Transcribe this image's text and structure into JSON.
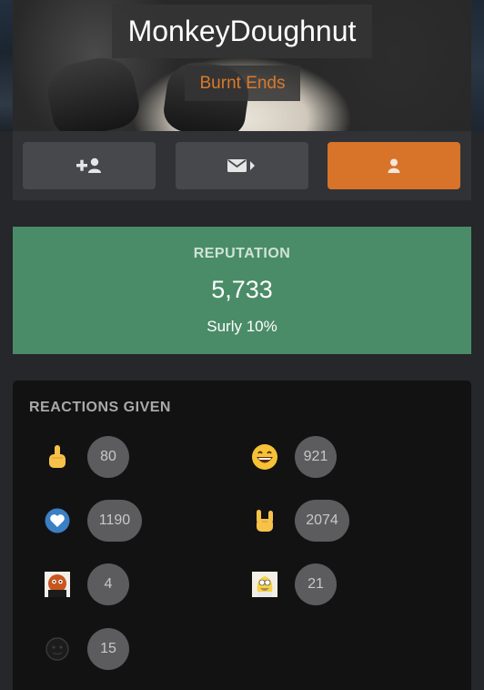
{
  "profile": {
    "username": "MonkeyDoughnut",
    "user_title": "Burnt Ends"
  },
  "actions": [
    {
      "icon": "add-user-icon"
    },
    {
      "icon": "message-icon"
    },
    {
      "icon": "user-icon"
    }
  ],
  "reputation": {
    "label": "REPUTATION",
    "value": "5,733",
    "rank": "Surly 10%"
  },
  "reactions": {
    "title": "REACTIONS GIVEN",
    "items": [
      {
        "icon": "middle-finger-icon",
        "count": "80"
      },
      {
        "icon": "grinning-face-icon",
        "count": "921"
      },
      {
        "icon": "heart-icon",
        "count": "1190"
      },
      {
        "icon": "rock-on-hand-icon",
        "count": "2074"
      },
      {
        "icon": "gritty-mascot-icon",
        "count": "4"
      },
      {
        "icon": "homer-simpson-icon",
        "count": "21"
      },
      {
        "icon": "dark-emoji-icon",
        "count": "15"
      }
    ]
  },
  "colors": {
    "accent": "#d8732a",
    "reputation_bg": "#4a8c68",
    "page_bg": "#25272a"
  }
}
